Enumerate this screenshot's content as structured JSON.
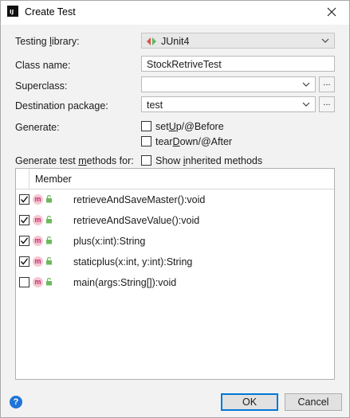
{
  "window": {
    "title": "Create Test",
    "app_icon": "intellij-icon",
    "app_icon_text": "IJ"
  },
  "form": {
    "testing_library": {
      "label_pre": "Testing ",
      "label_u": "l",
      "label_post": "ibrary:",
      "value": "JUnit4",
      "icon": "junit-arrows-icon"
    },
    "class_name": {
      "label": "Class name:",
      "value": "StockRetriveTest"
    },
    "superclass": {
      "label": "Superclass:",
      "value": "",
      "button": "..."
    },
    "destination_package": {
      "label": "Destination package:",
      "value": "test",
      "button": "..."
    },
    "generate": {
      "label": "Generate:",
      "options": [
        {
          "pre": "set",
          "u": "U",
          "post": "p/@Before",
          "checked": false
        },
        {
          "pre": "tear",
          "u": "D",
          "post": "own/@After",
          "checked": false
        }
      ]
    },
    "methods_for": {
      "label_pre": "Generate test ",
      "label_u": "m",
      "label_post": "ethods for:"
    },
    "show_inherited": {
      "pre": "Show ",
      "u": "i",
      "post": "nherited methods",
      "checked": false
    }
  },
  "members_table": {
    "header": "Member",
    "rows": [
      {
        "name": "retrieveAndSaveMaster():void",
        "checked": true
      },
      {
        "name": "retrieveAndSaveValue():void",
        "checked": true
      },
      {
        "name": "plus(x:int):String",
        "checked": true
      },
      {
        "name": "staticplus(x:int, y:int):String",
        "checked": true
      },
      {
        "name": "main(args:String[]):void",
        "checked": false
      }
    ],
    "method_badge": "m"
  },
  "footer": {
    "ok": "OK",
    "cancel": "Cancel",
    "help": "?"
  }
}
